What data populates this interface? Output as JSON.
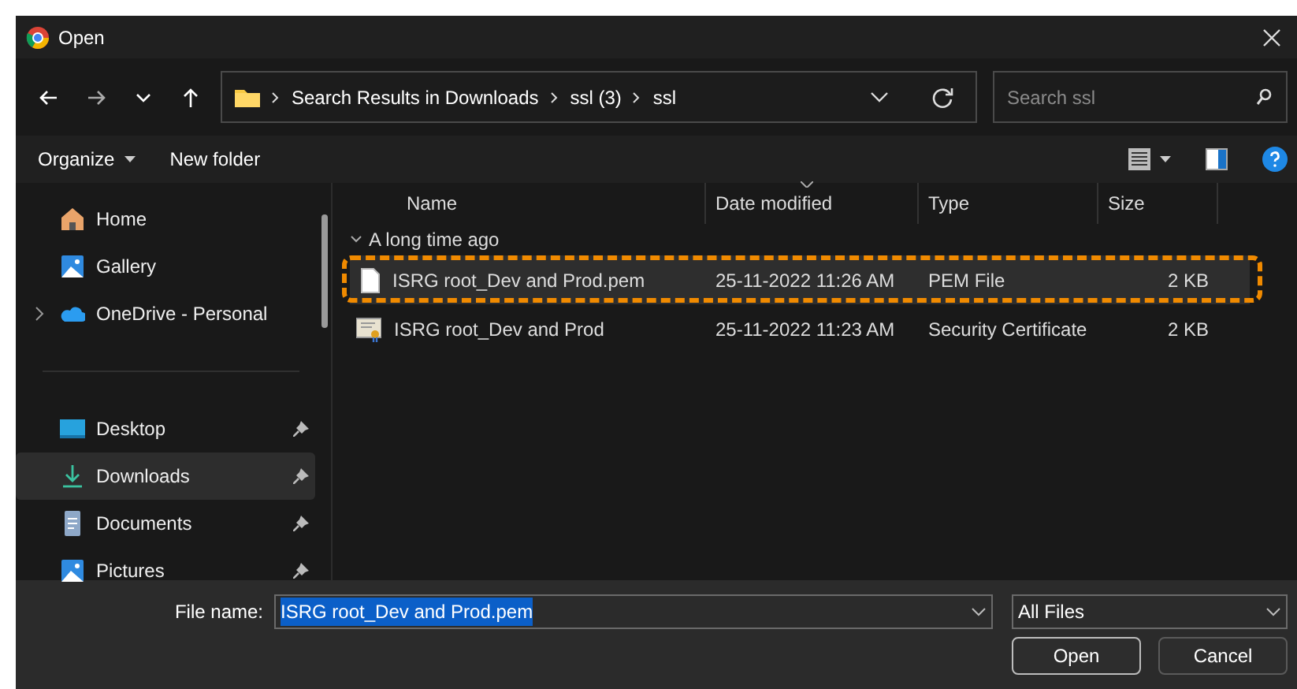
{
  "window": {
    "title": "Open"
  },
  "address": {
    "crumbs": [
      "Search Results in Downloads",
      "ssl (3)",
      "ssl"
    ]
  },
  "search": {
    "placeholder": "Search ssl"
  },
  "toolbar": {
    "organize": "Organize",
    "new_folder": "New folder"
  },
  "sidebar": {
    "sections": [
      [
        {
          "label": "Home",
          "kind": "home",
          "pinned": false,
          "selected": false,
          "expandable": false
        },
        {
          "label": "Gallery",
          "kind": "gallery",
          "pinned": false,
          "selected": false,
          "expandable": false
        },
        {
          "label": "OneDrive - Personal",
          "kind": "cloud",
          "pinned": false,
          "selected": false,
          "expandable": true
        }
      ],
      [
        {
          "label": "Desktop",
          "kind": "desktop",
          "pinned": true,
          "selected": false,
          "expandable": false
        },
        {
          "label": "Downloads",
          "kind": "download",
          "pinned": true,
          "selected": true,
          "expandable": false
        },
        {
          "label": "Documents",
          "kind": "document",
          "pinned": true,
          "selected": false,
          "expandable": false
        },
        {
          "label": "Pictures",
          "kind": "gallery",
          "pinned": true,
          "selected": false,
          "expandable": false
        }
      ]
    ]
  },
  "table": {
    "columns": [
      {
        "label": "Name",
        "sorted": false
      },
      {
        "label": "Date modified",
        "sorted": true
      },
      {
        "label": "Type",
        "sorted": false
      },
      {
        "label": "Size",
        "sorted": false
      }
    ],
    "group": {
      "label": "A long time ago",
      "expanded": true
    },
    "rows": [
      {
        "kind": "file",
        "cells": [
          "ISRG root_Dev and Prod.pem",
          "25-11-2022 11:26 AM",
          "PEM File",
          "2 KB"
        ],
        "selected": true,
        "annotated": true
      },
      {
        "kind": "certificate",
        "cells": [
          "ISRG root_Dev and Prod",
          "25-11-2022 11:23 AM",
          "Security Certificate",
          "2 KB"
        ],
        "selected": false,
        "annotated": false
      }
    ]
  },
  "footer": {
    "filename_label": "File name:",
    "filename_value": "ISRG root_Dev and Prod.pem",
    "filetype": "All Files",
    "buttons": [
      {
        "label": "Open",
        "kind": "primary"
      },
      {
        "label": "Cancel",
        "kind": "secondary"
      }
    ]
  }
}
